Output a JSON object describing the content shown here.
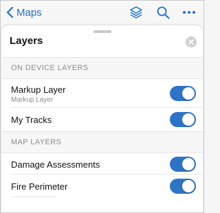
{
  "nav": {
    "back_label": "Maps",
    "accent_color": "#1f6fd1",
    "icons": [
      "layers-icon",
      "search-icon",
      "more-icon"
    ]
  },
  "sheet": {
    "title": "Layers",
    "close_icon": "close-icon"
  },
  "sections": [
    {
      "header": "ON DEVICE LAYERS",
      "rows": [
        {
          "title": "Markup Layer",
          "subtitle": "Markup Layer",
          "on": true
        },
        {
          "title": "My Tracks",
          "on": true
        }
      ]
    },
    {
      "header": "MAP LAYERS",
      "rows": [
        {
          "title": "Damage Assessments",
          "on": true
        },
        {
          "title": "Fire Perimeter",
          "on": true
        }
      ]
    }
  ],
  "toggle_on_color": "#2f73c7"
}
